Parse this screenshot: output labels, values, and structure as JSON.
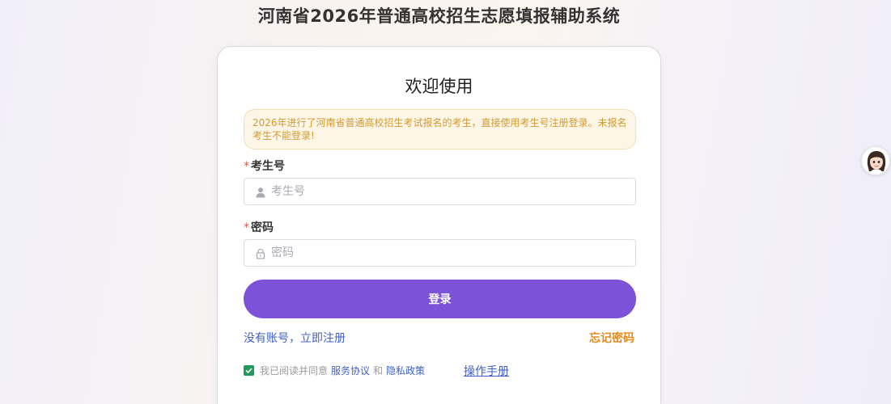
{
  "page": {
    "title": "河南省2026年普通高校招生志愿填报辅助系统"
  },
  "card": {
    "welcome": "欢迎使用",
    "notice": "2026年进行了河南省普通高校招生考试报名的考生，直接使用考生号注册登录。未报名考生不能登录!",
    "fields": {
      "exam_id": {
        "label": "考生号",
        "required_mark": "*",
        "placeholder": "考生号",
        "icon": "user-icon"
      },
      "password": {
        "label": "密码",
        "required_mark": "*",
        "placeholder": "密码",
        "icon": "lock-icon"
      }
    },
    "login_button": "登录",
    "register_link": "没有账号，立即注册",
    "forgot_link": "忘记密码",
    "agreement": {
      "checked": true,
      "prefix": "我已阅读并同意",
      "service_link": "服务协议",
      "and": "和",
      "privacy_link": "隐私政策"
    },
    "manual_link": "操作手册"
  },
  "colors": {
    "primary": "#7b52d8",
    "link": "#3f5fc5",
    "warning": "#e08a1e",
    "checkbox": "#1f9a5a"
  }
}
